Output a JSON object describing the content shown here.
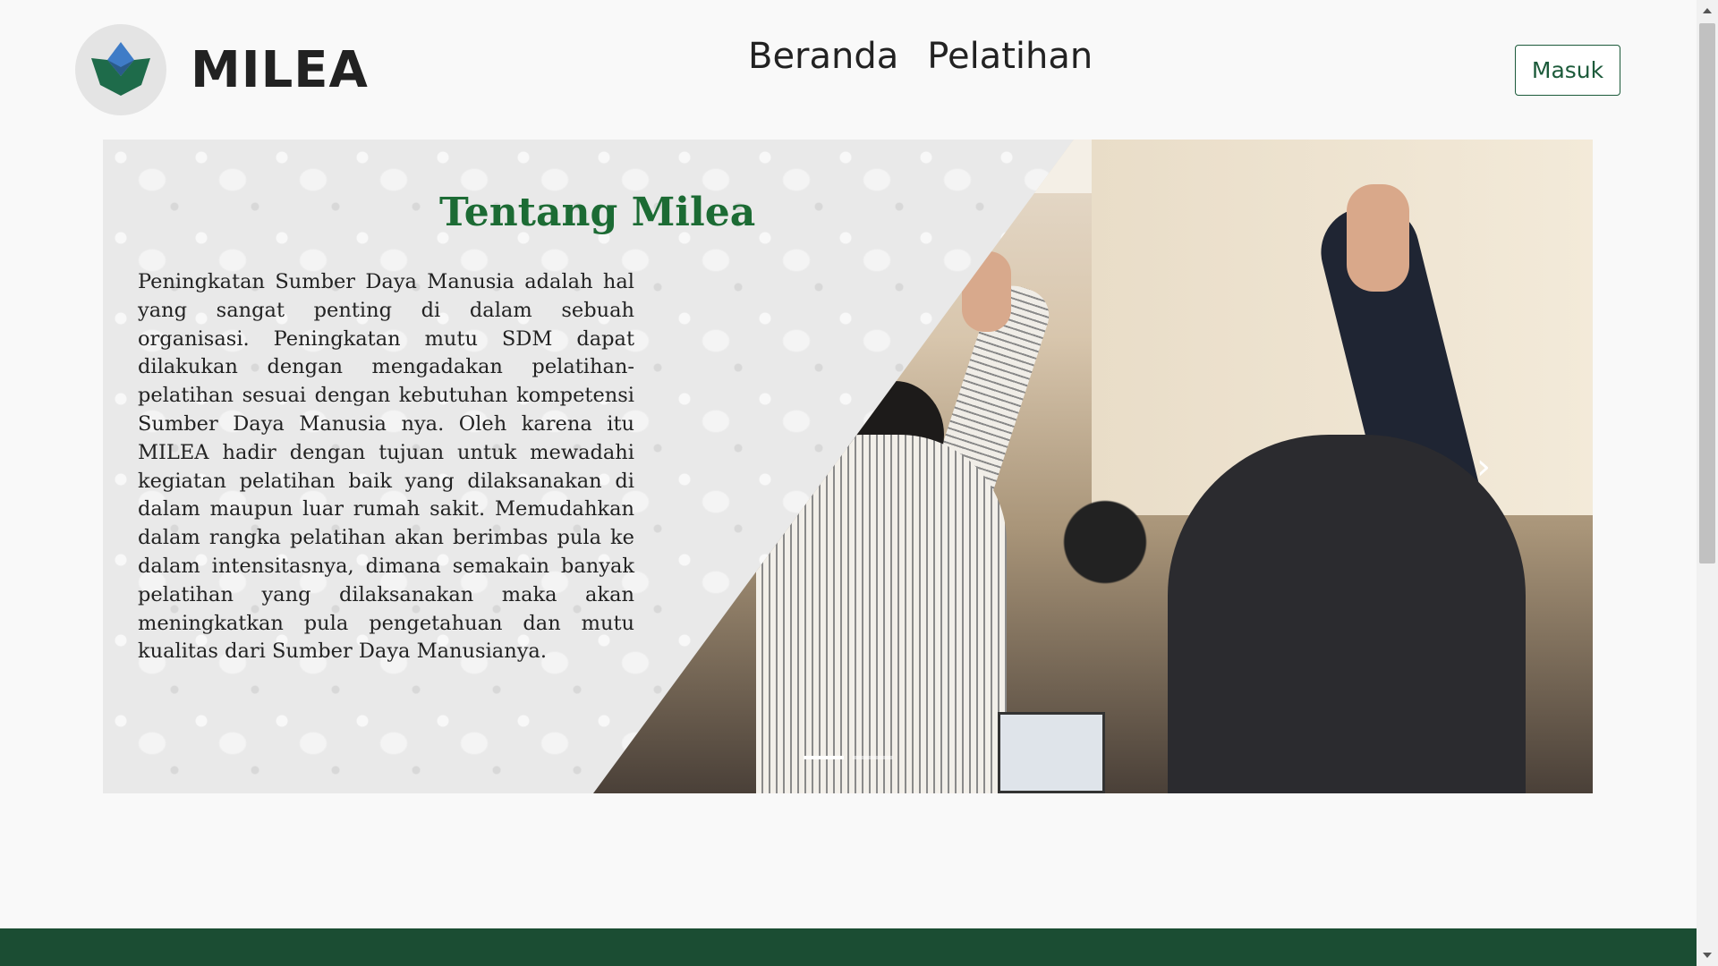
{
  "header": {
    "brand": "MILEA",
    "logo_icon": "milea-logo-icon",
    "nav": [
      {
        "label": "Beranda"
      },
      {
        "label": "Pelatihan"
      }
    ],
    "login_label": "Masuk"
  },
  "carousel": {
    "slide": {
      "title": "Tentang Milea",
      "text": "Peningkatan  Sumber Daya Manusia adalah hal yang sangat penting di dalam sebuah organisasi. Peningkatan mutu SDM  dapat dilakukan dengan mengadakan pelatihan-pelatihan sesuai dengan kebutuhan kompetensi Sumber Daya Manusia nya. Oleh karena itu MILEA hadir dengan tujuan untuk mewadahi kegiatan pelatihan baik yang dilaksanakan di dalam maupun luar rumah sakit. Memudahkan dalam rangka pelatihan akan berimbas pula ke dalam intensitasnya, dimana semakain banyak pelatihan yang dilaksanakan maka akan meningkatkan pula pengetahuan dan mutu kualitas dari Sumber Daya Manusianya."
    },
    "next_icon": "chevron-right-icon",
    "next_glyph": "›",
    "indicator_count": 2,
    "active_indicator": 1
  },
  "colors": {
    "brand_green": "#1c5a3a",
    "title_green": "#1c6b34",
    "footer_green": "#1b4d33"
  }
}
